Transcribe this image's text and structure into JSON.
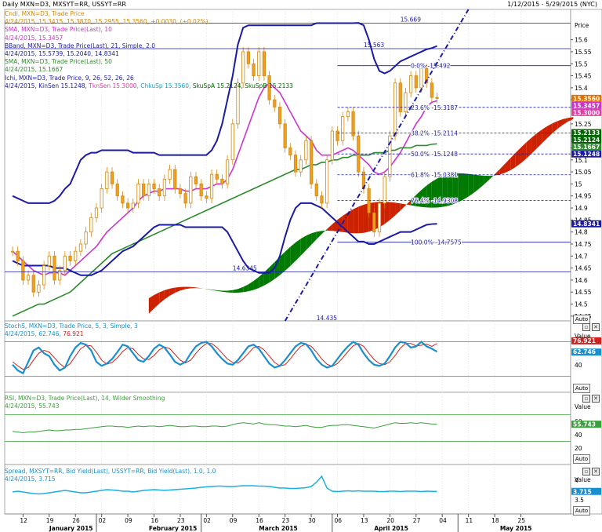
{
  "header": {
    "left": "Daily MXN=D3, MXSYT=RR, USSYT=RR",
    "right": "1/12/2015 - 5/29/2015 (NYC)"
  },
  "main": {
    "price_label": "Price",
    "auto": "Auto",
    "legend": [
      {
        "text": "Cndl, MXN=D3, Trade Price",
        "color": "#d4870f"
      },
      {
        "text": "4/24/2015, 15.3415, 15.3870, 15.2955, 15.3560, +0.0030, (+0.02%)",
        "color": "#d4870f"
      },
      {
        "text": "SMA, MXN=D3, Trade Price(Last), 10",
        "color": "#cc33cc"
      },
      {
        "text": "4/24/2015, 15.3457",
        "color": "#cc33cc"
      },
      {
        "text": "BBand, MXN=D3, Trade Price(Last), 21, Simple, 2.0",
        "color": "#1a1aa6"
      },
      {
        "text": "4/24/2015, 15.5739, 15.2040, 14.8341",
        "color": "#1a1aa6"
      },
      {
        "text": "SMA, MXN=D3, Trade Price(Last), 50",
        "color": "#2e8b2e"
      },
      {
        "text": "4/24/2015, 15.1667",
        "color": "#2e8b2e"
      },
      {
        "text": "Ichi, MXN=D3, Trade Price, 9, 26, 52, 26, 26",
        "color": "#1a1aa6"
      }
    ],
    "ichi_values": [
      {
        "text": "4/24/2015, KinSen 15.1248, ",
        "color": "#1a1aa6"
      },
      {
        "text": "TknSen 15.3000, ",
        "color": "#e040a0"
      },
      {
        "text": "ChkuSp 15.3560, ",
        "color": "#20a0c0"
      },
      {
        "text": "SkuSpA 15.2124, ",
        "color": "#006400"
      },
      {
        "text": "SkuSpB 15.2133",
        "color": "#006400"
      }
    ],
    "y_ticks": [
      "15.6",
      "15.55",
      "15.5",
      "15.45",
      "15.4",
      "15.35",
      "15.25",
      "15.2",
      "15.15",
      "15.1",
      "15.05",
      "15",
      "14.95",
      "14.9",
      "14.85",
      "14.8",
      "14.75",
      "14.7",
      "14.65",
      "14.6",
      "14.55",
      "14.5",
      "14.45"
    ],
    "hlines": [
      {
        "value": 15.669,
        "label": "15.669"
      },
      {
        "value": 15.563,
        "label": "15.563"
      },
      {
        "value": 14.6345,
        "label": "14.6345"
      }
    ],
    "fib_levels": [
      {
        "value": 15.492,
        "pct": "0.0%",
        "label": "15.492"
      },
      {
        "value": 15.3187,
        "pct": "23.6%",
        "label": "15.3187"
      },
      {
        "value": 15.2114,
        "pct": "38.2%",
        "label": "15.2114"
      },
      {
        "value": 15.1248,
        "pct": "50.0%",
        "label": "15.1248"
      },
      {
        "value": 15.0381,
        "pct": "61.8%",
        "label": "15.0381"
      },
      {
        "value": 14.9308,
        "pct": "76.4%",
        "label": "14.9308"
      },
      {
        "value": 14.7575,
        "pct": "100.0%",
        "label": "14.7575"
      }
    ],
    "bottom_label": "14.435",
    "value_tags": [
      {
        "label": "15.3560",
        "value": 15.356,
        "color": "#e07000"
      },
      {
        "label": "15.3457",
        "value": 15.3457,
        "color": "#cc33cc"
      },
      {
        "label": "15.3000",
        "value": 15.3,
        "color": "#e040a0"
      },
      {
        "label": "15.2133",
        "value": 15.2133,
        "color": "#006400"
      },
      {
        "label": "15.2124",
        "value": 15.2124,
        "color": "#006400"
      },
      {
        "label": "15.1667",
        "value": 15.1667,
        "color": "#2e8b2e"
      },
      {
        "label": "15.1248",
        "value": 15.1248,
        "color": "#1a1aa6"
      },
      {
        "label": "14.8341",
        "value": 14.8341,
        "color": "#1a1aa6"
      }
    ]
  },
  "stoch": {
    "legend": "StochS, MXN=D3, Trade Price,  5, 3, Simple, 3",
    "values_date": "4/24/2015, ",
    "k": "62.746",
    "d": "76.921",
    "value_label": "Value",
    "ticks": [
      "60",
      "40"
    ],
    "auto": "Auto"
  },
  "rsi": {
    "legend": "RSI, MXN=D3, Trade Price(Last),  14, Wilder Smoothing",
    "value_text": "4/24/2015, 55.743",
    "tag": "55.743",
    "value_label": "Value",
    "ticks": [
      "60",
      "40",
      "20"
    ],
    "auto": "Auto"
  },
  "spread": {
    "legend": "Spread, MXSYT=RR, Bid Yield(Last), USSYT=RR, Bid Yield(Last),  1.0, 1.0",
    "value_text": "4/24/2015, 3.715",
    "tag": "3.715",
    "value_label": "Value",
    "ticks": [
      "4",
      "3.5"
    ],
    "auto": "Auto"
  },
  "x_axis": {
    "days": [
      "12",
      "19",
      "26",
      "02",
      "09",
      "16",
      "23",
      "02",
      "09",
      "16",
      "23",
      "30",
      "06",
      "13",
      "20",
      "27",
      "04",
      "11",
      "18",
      "25"
    ],
    "months": [
      "January 2015",
      "February 2015",
      "March 2015",
      "April 2015",
      "May 2015"
    ]
  },
  "chart_data": {
    "type": "candlestick",
    "title": "Daily MXN=D3",
    "ylim": [
      14.43,
      15.7
    ],
    "series": [
      {
        "name": "Cndl MXN=D3 close",
        "values": [
          14.72,
          14.68,
          14.6,
          14.62,
          14.55,
          14.58,
          14.66,
          14.7,
          14.6,
          14.64,
          14.7,
          14.68,
          14.72,
          14.75,
          14.8,
          14.86,
          14.9,
          14.98,
          15.05,
          15.0,
          14.95,
          14.92,
          14.9,
          14.92,
          15.0,
          14.95,
          15.0,
          14.98,
          14.95,
          15.02,
          15.06,
          14.98,
          14.96,
          14.92,
          15.03,
          15.0,
          14.95,
          14.94,
          15.04,
          15.02,
          15.0,
          15.1,
          15.25,
          15.42,
          15.55,
          15.5,
          15.45,
          15.55,
          15.45,
          15.35,
          15.32,
          15.25,
          15.15,
          15.12,
          15.05,
          15.1,
          15.18,
          15.0,
          14.95,
          14.92,
          15.1,
          15.22,
          15.18,
          15.28,
          15.3,
          15.2,
          15.05,
          14.98,
          14.88,
          14.8,
          14.92,
          15.03,
          15.2,
          15.42,
          15.3,
          15.38,
          15.45,
          15.4,
          15.48,
          15.42,
          15.36,
          15.356
        ]
      },
      {
        "name": "SMA 10",
        "values": [
          14.72,
          14.7,
          14.68,
          14.66,
          14.64,
          14.63,
          14.62,
          14.63,
          14.63,
          14.63,
          14.62,
          14.64,
          14.66,
          14.68,
          14.7,
          14.72,
          14.74,
          14.77,
          14.8,
          14.82,
          14.84,
          14.86,
          14.88,
          14.9,
          14.93,
          14.95,
          14.96,
          14.97,
          14.97,
          14.98,
          14.98,
          14.98,
          14.98,
          14.97,
          14.97,
          14.98,
          14.98,
          14.98,
          14.99,
          15.0,
          15.0,
          15.02,
          15.06,
          15.12,
          15.18,
          15.24,
          15.3,
          15.36,
          15.4,
          15.42,
          15.4,
          15.38,
          15.34,
          15.3,
          15.26,
          15.22,
          15.2,
          15.18,
          15.14,
          15.12,
          15.12,
          15.12,
          15.13,
          15.14,
          15.15,
          15.14,
          15.12,
          15.1,
          15.08,
          15.05,
          15.04,
          15.05,
          15.07,
          15.1,
          15.13,
          15.17,
          15.21,
          15.25,
          15.28,
          15.32,
          15.34,
          15.3457
        ]
      },
      {
        "name": "SMA 50",
        "values": [
          14.45,
          14.46,
          14.47,
          14.48,
          14.49,
          14.5,
          14.5,
          14.51,
          14.52,
          14.53,
          14.54,
          14.55,
          14.57,
          14.59,
          14.61,
          14.63,
          14.65,
          14.67,
          14.69,
          14.71,
          14.72,
          14.73,
          14.74,
          14.75,
          14.76,
          14.77,
          14.78,
          14.79,
          14.8,
          14.81,
          14.82,
          14.83,
          14.84,
          14.85,
          14.86,
          14.87,
          14.88,
          14.89,
          14.9,
          14.91,
          14.92,
          14.93,
          14.94,
          14.95,
          14.96,
          14.97,
          14.98,
          14.99,
          15.0,
          15.01,
          15.02,
          15.03,
          15.04,
          15.05,
          15.06,
          15.06,
          15.07,
          15.08,
          15.08,
          15.09,
          15.09,
          15.1,
          15.1,
          15.11,
          15.11,
          15.12,
          15.12,
          15.12,
          15.12,
          15.13,
          15.13,
          15.13,
          15.14,
          15.14,
          15.15,
          15.15,
          15.15,
          15.16,
          15.16,
          15.16,
          15.165,
          15.1667
        ]
      },
      {
        "name": "BBand upper",
        "values": [
          14.95,
          14.94,
          14.93,
          14.92,
          14.92,
          14.92,
          14.92,
          14.92,
          14.93,
          14.95,
          14.98,
          15.0,
          15.05,
          15.1,
          15.12,
          15.13,
          15.13,
          15.14,
          15.14,
          15.14,
          15.14,
          15.14,
          15.14,
          15.13,
          15.13,
          15.13,
          15.13,
          15.13,
          15.12,
          15.12,
          15.12,
          15.12,
          15.12,
          15.12,
          15.12,
          15.12,
          15.12,
          15.12,
          15.14,
          15.18,
          15.25,
          15.35,
          15.45,
          15.58,
          15.65,
          15.66,
          15.66,
          15.66,
          15.66,
          15.66,
          15.66,
          15.66,
          15.66,
          15.66,
          15.66,
          15.66,
          15.66,
          15.66,
          15.669,
          15.669,
          15.669,
          15.669,
          15.669,
          15.669,
          15.669,
          15.669,
          15.67,
          15.66,
          15.6,
          15.52,
          15.47,
          15.46,
          15.47,
          15.49,
          15.51,
          15.52,
          15.53,
          15.54,
          15.55,
          15.56,
          15.565,
          15.5739
        ]
      },
      {
        "name": "BBand lower",
        "values": [
          14.68,
          14.67,
          14.66,
          14.66,
          14.66,
          14.66,
          14.66,
          14.66,
          14.65,
          14.65,
          14.65,
          14.64,
          14.63,
          14.62,
          14.62,
          14.62,
          14.63,
          14.64,
          14.66,
          14.68,
          14.7,
          14.72,
          14.73,
          14.74,
          14.76,
          14.78,
          14.8,
          14.82,
          14.83,
          14.83,
          14.83,
          14.83,
          14.83,
          14.82,
          14.82,
          14.82,
          14.82,
          14.82,
          14.82,
          14.82,
          14.82,
          14.8,
          14.76,
          14.72,
          14.68,
          14.65,
          14.64,
          14.63,
          14.63,
          14.63,
          14.65,
          14.7,
          14.78,
          14.85,
          14.9,
          14.92,
          14.92,
          14.92,
          14.91,
          14.9,
          14.88,
          14.86,
          14.84,
          14.82,
          14.8,
          14.78,
          14.76,
          14.76,
          14.75,
          14.75,
          14.76,
          14.77,
          14.78,
          14.79,
          14.8,
          14.8,
          14.8,
          14.81,
          14.82,
          14.83,
          14.833,
          14.8341
        ]
      },
      {
        "name": "StochS %K",
        "values": [
          40,
          30,
          25,
          45,
          65,
          70,
          60,
          55,
          40,
          30,
          35,
          55,
          70,
          78,
          75,
          65,
          45,
          38,
          42,
          50,
          62,
          75,
          72,
          60,
          48,
          45,
          55,
          68,
          75,
          70,
          58,
          45,
          40,
          45,
          60,
          72,
          78,
          80,
          72,
          60,
          50,
          42,
          40,
          48,
          60,
          72,
          75,
          68,
          55,
          42,
          35,
          38,
          48,
          60,
          72,
          78,
          76,
          65,
          50,
          40,
          35,
          38,
          50,
          62,
          72,
          80,
          75,
          60,
          48,
          40,
          38,
          42,
          55,
          70,
          80,
          78,
          70,
          72,
          80,
          72,
          68,
          62.746
        ]
      },
      {
        "name": "StochS %D",
        "values": [
          45,
          38,
          32,
          35,
          48,
          60,
          65,
          62,
          52,
          42,
          35,
          42,
          55,
          68,
          74,
          73,
          62,
          48,
          41,
          44,
          52,
          63,
          70,
          68,
          58,
          50,
          49,
          56,
          66,
          71,
          68,
          58,
          48,
          43,
          48,
          60,
          70,
          77,
          77,
          70,
          60,
          50,
          44,
          43,
          50,
          60,
          70,
          72,
          66,
          55,
          44,
          38,
          40,
          50,
          62,
          72,
          76,
          72,
          62,
          50,
          41,
          37,
          42,
          52,
          63,
          73,
          77,
          72,
          60,
          49,
          42,
          40,
          45,
          56,
          69,
          77,
          77,
          73,
          74,
          76,
          72,
          76.921
        ]
      },
      {
        "name": "RSI 14",
        "values": [
          45,
          44,
          43,
          44,
          44,
          45,
          46,
          47,
          46,
          46,
          47,
          47,
          48,
          48,
          49,
          50,
          51,
          52,
          53,
          53,
          52,
          52,
          51,
          52,
          53,
          52,
          53,
          53,
          52,
          53,
          54,
          53,
          52,
          52,
          53,
          53,
          52,
          52,
          53,
          53,
          52,
          53,
          55,
          57,
          58,
          57,
          56,
          58,
          56,
          55,
          55,
          54,
          53,
          53,
          52,
          53,
          54,
          52,
          51,
          51,
          53,
          54,
          54,
          55,
          55,
          54,
          53,
          52,
          51,
          50,
          52,
          54,
          56,
          58,
          57,
          57,
          58,
          57,
          58,
          57,
          56,
          55.743
        ]
      },
      {
        "name": "Spread",
        "values": [
          3.7,
          3.72,
          3.7,
          3.68,
          3.66,
          3.65,
          3.66,
          3.68,
          3.7,
          3.72,
          3.74,
          3.72,
          3.7,
          3.68,
          3.68,
          3.7,
          3.72,
          3.74,
          3.76,
          3.75,
          3.74,
          3.72,
          3.72,
          3.7,
          3.72,
          3.74,
          3.75,
          3.76,
          3.75,
          3.74,
          3.75,
          3.76,
          3.77,
          3.78,
          3.79,
          3.8,
          3.82,
          3.83,
          3.84,
          3.85,
          3.85,
          3.84,
          3.84,
          3.85,
          3.86,
          3.86,
          3.86,
          3.85,
          3.85,
          3.84,
          3.82,
          3.8,
          3.8,
          3.79,
          3.79,
          3.8,
          3.81,
          3.84,
          3.95,
          4.1,
          3.8,
          3.72,
          3.71,
          3.72,
          3.73,
          3.72,
          3.73,
          3.72,
          3.72,
          3.72,
          3.71,
          3.71,
          3.72,
          3.72,
          3.71,
          3.72,
          3.72,
          3.72,
          3.71,
          3.72,
          3.715,
          3.715
        ]
      }
    ]
  }
}
